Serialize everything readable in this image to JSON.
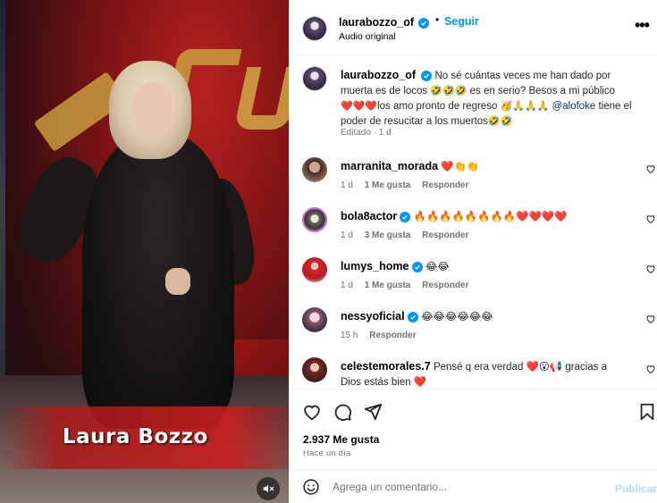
{
  "media": {
    "caption_overlay": "Laura Bozzo",
    "mute_icon": "speaker-muted-icon"
  },
  "header": {
    "username": "laurabozzo_of",
    "separator": "•",
    "follow_label": "Seguir",
    "subtitle": "Audio original",
    "more_icon": "ellipsis-icon",
    "more_label": "•••"
  },
  "post_caption": {
    "username": "laurabozzo_of",
    "text_part1": "No sé cuántas veces me han dado por muerta es de locos ",
    "emoji1": "🤣🤣🤣",
    "text_part2": " es en serio? Besos a mi público ",
    "emoji2": "❤️❤️❤️",
    "text_part3": "los amo pronto de regreso ",
    "emoji3": "🥳🙏🙏🙏",
    "mention": "@alofoke",
    "text_part4": " tiene el poder de resucitar a los muertos",
    "emoji4": "🤣🤣",
    "meta": "Editado · 1 d"
  },
  "comments": [
    {
      "username": "marranita_morada",
      "verified": false,
      "text": "❤️👏👏",
      "time": "1 d",
      "likes": "1 Me gusta",
      "reply": "Responder"
    },
    {
      "username": "bola8actor",
      "verified": true,
      "text": "🔥🔥🔥🔥🔥🔥🔥🔥❤️❤️❤️❤️",
      "time": "1 d",
      "likes": "3 Me gusta",
      "reply": "Responder"
    },
    {
      "username": "lumys_home",
      "verified": true,
      "text": "😂😂",
      "time": "1 d",
      "likes": "1 Me gusta",
      "reply": "Responder"
    },
    {
      "username": "nessyoficial",
      "verified": true,
      "text": "😂😂😂😂😂😂",
      "time": "15 h",
      "likes": "",
      "reply": "Responder"
    },
    {
      "username": "celestemorales.7",
      "verified": false,
      "text": "Pensé q era verdad ❤️😮📢 gracias a Dios estás bien ❤️",
      "time": "",
      "likes": "",
      "reply": ""
    }
  ],
  "actions": {
    "like_icon": "heart-icon",
    "comment_icon": "comment-bubble-icon",
    "share_icon": "paper-plane-icon",
    "save_icon": "bookmark-icon",
    "likes_count": "2.937 Me gusta",
    "time_ago": "Hace un día"
  },
  "add_comment": {
    "emoji_icon": "smiley-icon",
    "placeholder": "Agrega un comentario...",
    "publish_label": "Publicar"
  },
  "colors": {
    "accent_blue": "#0095f6",
    "publish_disabled": "#b3dbff",
    "meta_grey": "#737373"
  }
}
